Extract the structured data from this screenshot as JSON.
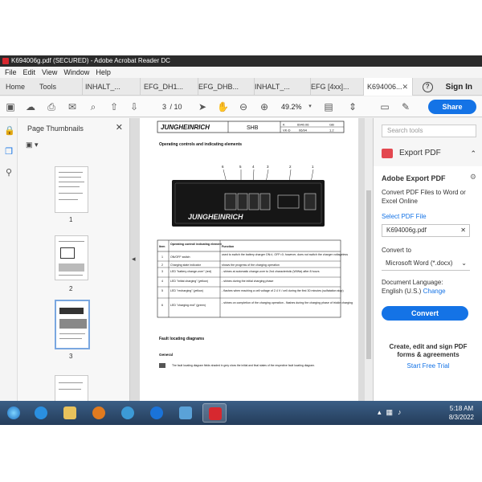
{
  "window": {
    "title": "K694006g.pdf (SECURED) - Adobe Acrobat Reader DC"
  },
  "menu": [
    "File",
    "Edit",
    "View",
    "Window",
    "Help"
  ],
  "tabs": {
    "home": "Home",
    "tools": "Tools",
    "docs": [
      "INHALT_...",
      "EFG_DH1...",
      "EFG_DHB...",
      "INHALT_...",
      "EFG [4xx]...",
      "K694006..."
    ],
    "sign_in": "Sign In"
  },
  "toolbar": {
    "current_page": "3",
    "total_pages": "/ 10",
    "zoom": "49.2%",
    "share_label": "Share"
  },
  "thumbnails": {
    "title": "Page Thumbnails",
    "pages": [
      "1",
      "2",
      "3"
    ]
  },
  "document": {
    "header": {
      "brand": "JUNGHEINRICH",
      "manual": "SHB",
      "code": "K",
      "doc_no": "6940.06",
      "lang": "GB",
      "vk": "VK-D",
      "date": "06/94",
      "rev": "1.2"
    },
    "heading": "Operating controls and indicating elements",
    "device_numbers": [
      "6",
      "5",
      "4",
      "3",
      "2",
      "1"
    ],
    "device_brand": "JUNGHEINRICH",
    "table": {
      "headers": [
        "Item",
        "Operating control/ indicating element",
        "Function"
      ],
      "rows": [
        [
          "1",
          "ON/OFF switch",
          "used to switch the battery charger ON=I, OFF=0; however, does not switch the charger voltageless"
        ],
        [
          "2",
          "Charging state indicator",
          "shows the progress of the charging operation"
        ],
        [
          "3",
          "LED \"battery change-over\" (red)",
          "- shines at automatic change-over to 2nd characteristic (WIWa) after 8 hours"
        ],
        [
          "4",
          "LED \"initial charging\" (yellow)",
          "- shines during the initial charging phase"
        ],
        [
          "5",
          "LED \"recharging\" (yellow)",
          "- flashes when reaching a cell voltage of 2.4 V / cell during the first 30 minutes (sulfatation stop)"
        ],
        [
          "6",
          "LED \"charging end\" (green)",
          "- shines on completion of the charging operation - flashes during the charging phase of trickle charging"
        ]
      ]
    },
    "fault_heading": "Fault locating diagrams",
    "general": "General",
    "general_text": "The fault locating diagram fields shaded in grey show the initial and final states of the respective fault locating diagram."
  },
  "right_pane": {
    "search_placeholder": "Search tools",
    "export_title": "Export PDF",
    "adobe_export": "Adobe Export PDF",
    "description": "Convert PDF Files to Word or Excel Online",
    "select_label": "Select PDF File",
    "file_name": "K694006g.pdf",
    "convert_to": "Convert to",
    "format": "Microsoft Word (*.docx)",
    "doc_language_label": "Document Language:",
    "doc_language": "English (U.S.)",
    "change": "Change",
    "convert_button": "Convert",
    "promo": "Create, edit and sign PDF forms & agreements",
    "trial": "Start Free Trial"
  },
  "taskbar": {
    "time": "5:18 AM",
    "date": "8/3/2022"
  },
  "colors": {
    "accent": "#1473e6",
    "titlebar": "#2b2b2b",
    "pdf_red": "#d7282f",
    "taskbar": "#2f4e73"
  }
}
